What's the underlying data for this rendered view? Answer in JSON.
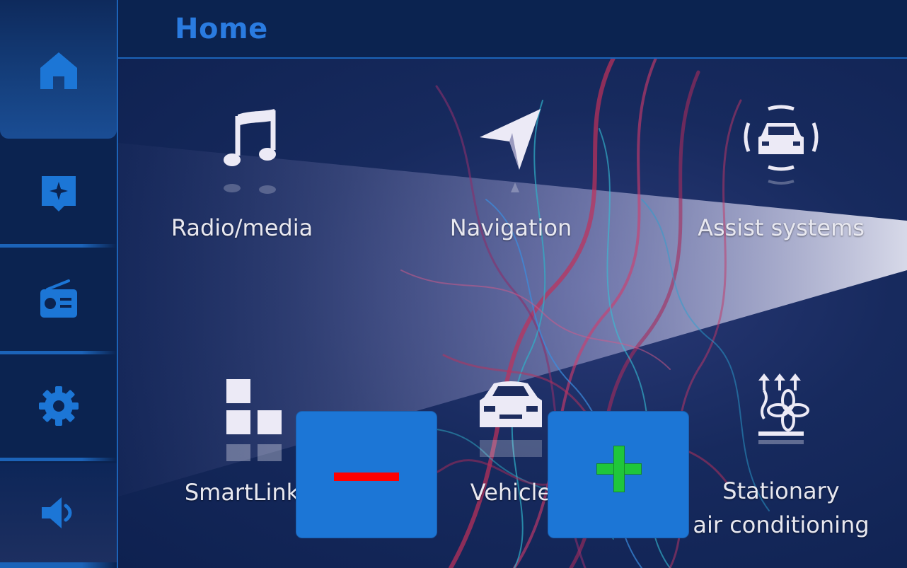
{
  "header": {
    "title": "Home"
  },
  "sidebar": {
    "items": [
      {
        "name": "home",
        "icon": "home-icon"
      },
      {
        "name": "favorites",
        "icon": "star-badge-icon"
      },
      {
        "name": "radio",
        "icon": "radio-icon"
      },
      {
        "name": "settings",
        "icon": "gear-icon"
      },
      {
        "name": "volume",
        "icon": "speaker-icon"
      }
    ]
  },
  "tiles": [
    {
      "label": "Radio/media",
      "icon": "music-note-icon"
    },
    {
      "label": "Navigation",
      "icon": "navigation-arrow-icon"
    },
    {
      "label": "Assist systems",
      "icon": "assist-car-icon"
    },
    {
      "label": "SmartLink",
      "icon": "smartlink-blocks-icon"
    },
    {
      "label": "Vehicle",
      "icon": "car-front-icon"
    },
    {
      "label_line1": "Stationary",
      "label_line2": "air conditioning",
      "icon": "heating-fan-icon"
    }
  ],
  "zoom": {
    "minus_icon": "minus-icon",
    "plus_icon": "plus-icon"
  },
  "colors": {
    "accent": "#1c76d6",
    "title": "#2a7be0",
    "minus": "#ff0000",
    "plus": "#1fc63b",
    "background": "#0b2350"
  }
}
